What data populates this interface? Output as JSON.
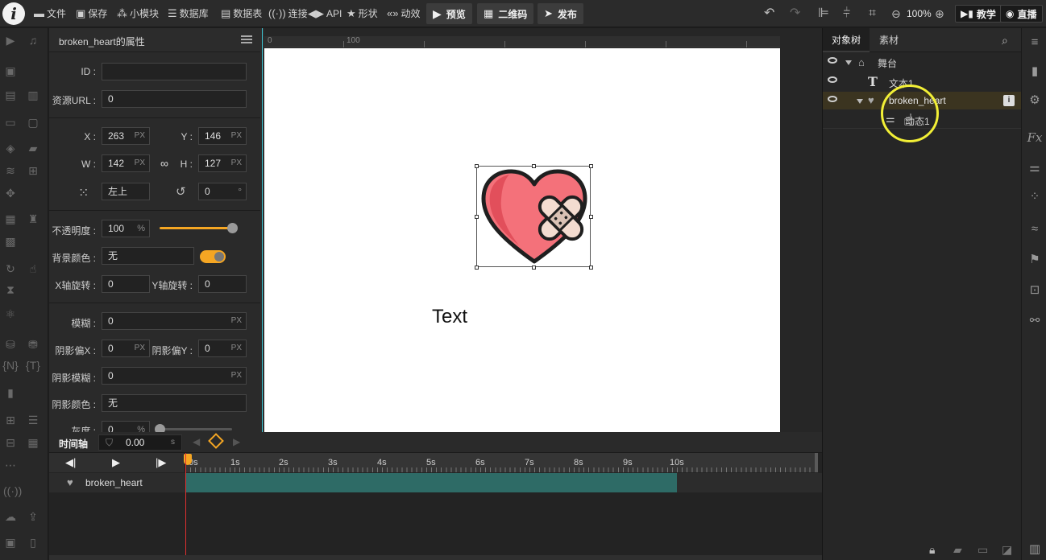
{
  "toolbar": {
    "file": "文件",
    "save": "保存",
    "module": "小模块",
    "database": "数据库",
    "datatable": "数据表",
    "connect": "连接",
    "api": "API",
    "shape": "形状",
    "animation": "动效",
    "preview": "预览",
    "qrcode": "二维码",
    "publish": "发布",
    "zoom": "100%",
    "tutorial": "教学",
    "live": "直播"
  },
  "props": {
    "title": "broken_heart的属性",
    "id_label": "ID",
    "id_value": "",
    "url_label": "资源URL",
    "url_value": "0",
    "x_label": "X",
    "x_value": "263",
    "y_label": "Y",
    "y_value": "146",
    "w_label": "W",
    "w_value": "142",
    "h_label": "H",
    "h_value": "127",
    "px": "PX",
    "anchor_value": "左上",
    "rotate_value": "0",
    "deg": "°",
    "opacity_label": "不透明度",
    "opacity_value": "100",
    "percent": "%",
    "bgcolor_label": "背景颜色",
    "bgcolor_value": "无",
    "xrot_label": "X轴旋转",
    "xrot_value": "0",
    "yrot_label": "Y轴旋转",
    "yrot_value": "0",
    "blur_label": "模糊",
    "blur_value": "0",
    "shx_label": "阴影偏X",
    "shx_value": "0",
    "shy_label": "阴影偏Y",
    "shy_value": "0",
    "shblur_label": "阴影模糊",
    "shblur_value": "0",
    "shcolor_label": "阴影颜色",
    "shcolor_value": "无",
    "gray_label": "灰度",
    "gray_value": "0"
  },
  "ruler": {
    "zero": "0",
    "hundred": "100"
  },
  "stage": {
    "text": "Text"
  },
  "right": {
    "tab_tree": "对象树",
    "tab_assets": "素材",
    "tree": [
      {
        "label": "舞台"
      },
      {
        "label": "文本1"
      },
      {
        "label": "broken_heart"
      },
      {
        "label": "动态1"
      }
    ]
  },
  "timeline": {
    "title": "时间轴",
    "time": "0.00",
    "unit": "s",
    "ticks": [
      "0s",
      "1s",
      "2s",
      "3s",
      "4s",
      "5s",
      "6s",
      "7s",
      "8s",
      "9s",
      "10s"
    ],
    "track": "broken_heart"
  },
  "colors": {
    "accent": "#f5a623",
    "track": "#2e6b66",
    "heart_fill": "#f4717a",
    "heart_dark": "#e24f5b",
    "highlight": "#f2ef36"
  }
}
